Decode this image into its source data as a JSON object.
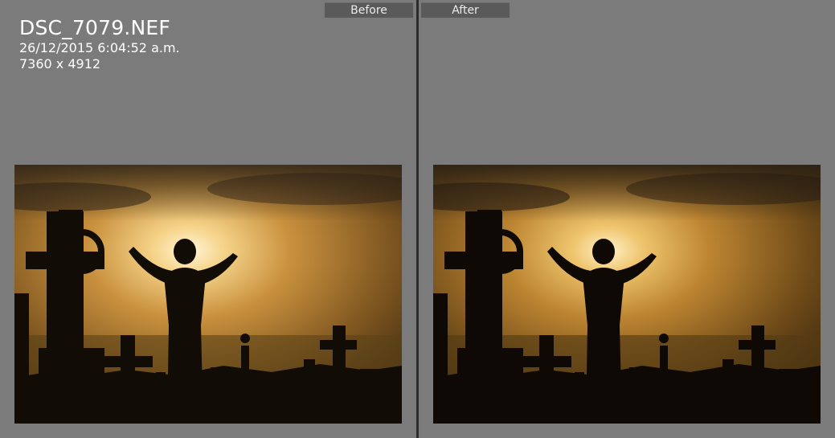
{
  "views": {
    "before_label": "Before",
    "after_label": "After"
  },
  "image_info": {
    "filename": "DSC_7079.NEF",
    "datetime": "26/12/2015 6:04:52 a.m.",
    "dimensions": "7360 x 4912"
  },
  "colors": {
    "background": "#7b7b7b",
    "label_bg": "#5a5a5a",
    "divider": "#2b2b2b"
  }
}
